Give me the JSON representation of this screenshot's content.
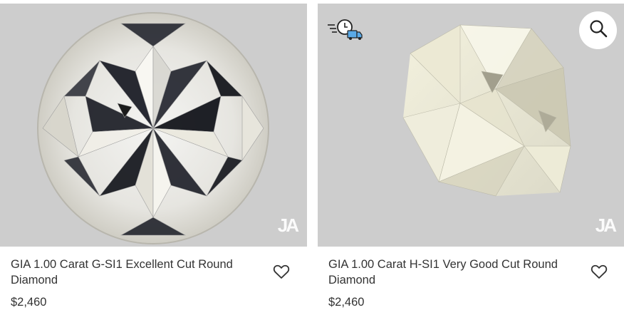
{
  "products": [
    {
      "title": "GIA 1.00 Carat G-SI1 Excellent Cut Round Diamond",
      "price": "$2,460",
      "logo": "JA",
      "icons": [
        "heart-icon"
      ]
    },
    {
      "title": "GIA 1.00 Carat H-SI1 Very Good Cut Round Diamond",
      "price": "$2,460",
      "logo": "JA",
      "icons": [
        "fast-shipping-icon",
        "search-icon",
        "heart-icon"
      ]
    }
  ],
  "colors": {
    "photo_bg": "#cdcdcd",
    "text": "#333333",
    "delivery_truck": "#5aa9e6"
  }
}
